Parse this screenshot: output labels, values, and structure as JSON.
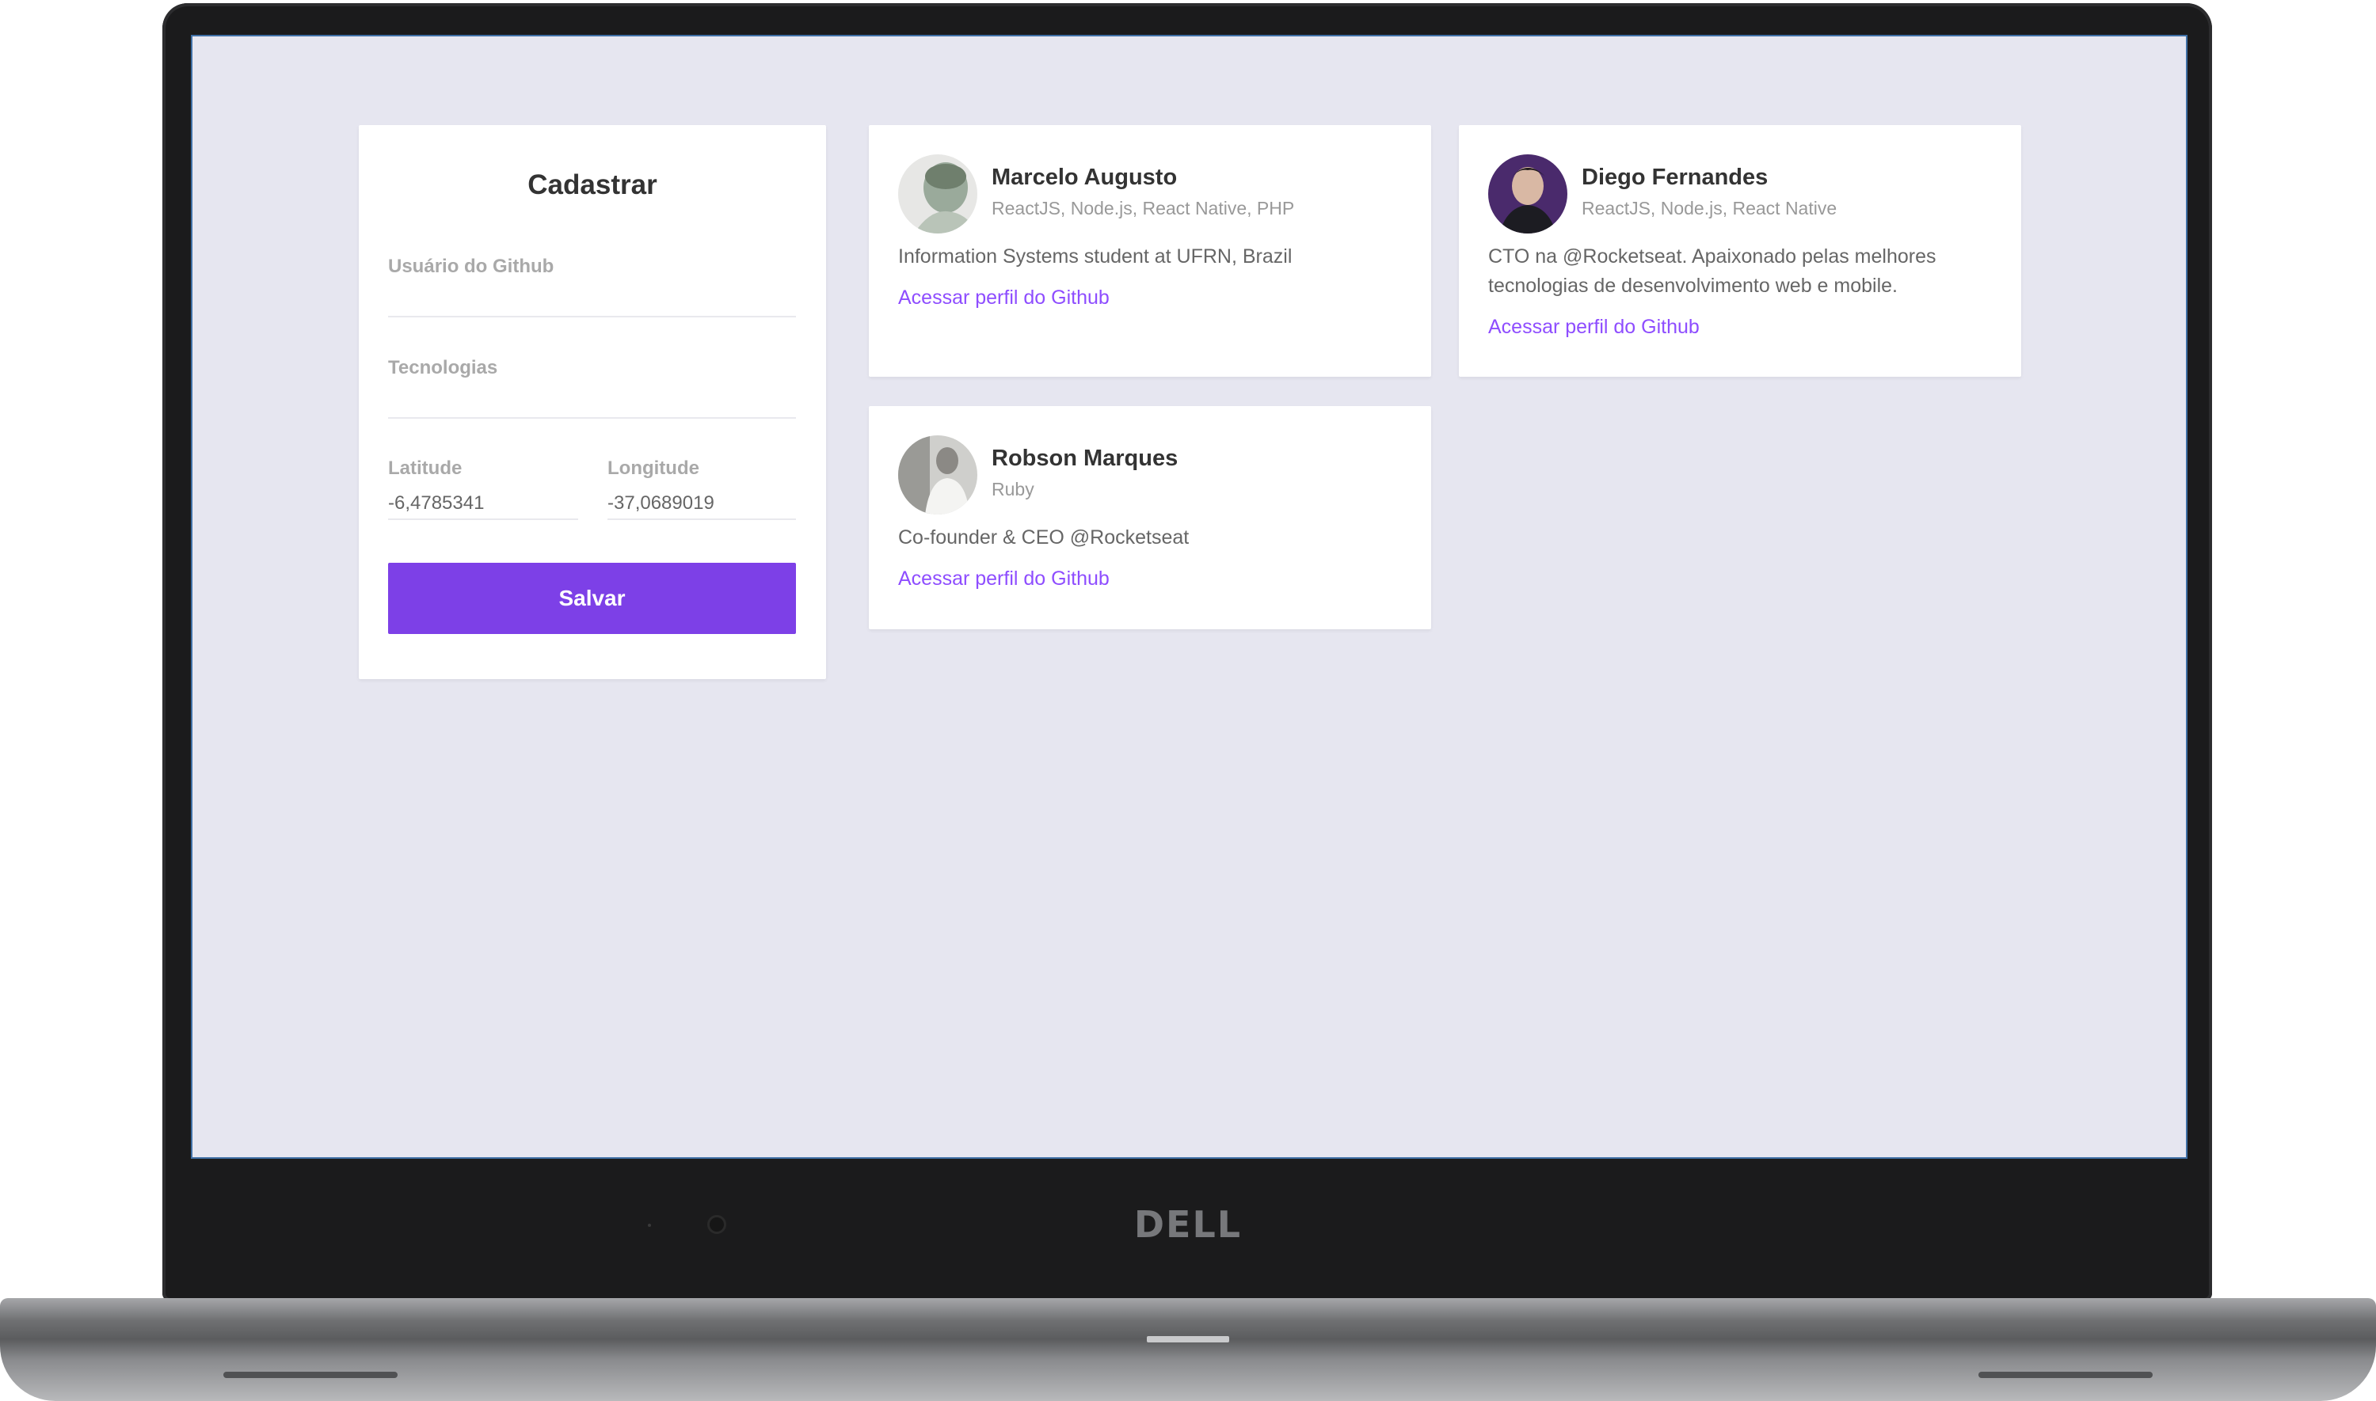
{
  "device": {
    "logo": "DELL"
  },
  "form": {
    "title": "Cadastrar",
    "github_label": "Usuário do Github",
    "github_value": "",
    "techs_label": "Tecnologias",
    "techs_value": "",
    "latitude_label": "Latitude",
    "latitude_value": "-6,4785341",
    "longitude_label": "Longitude",
    "longitude_value": "-37,0689019",
    "submit_label": "Salvar"
  },
  "devs": [
    {
      "name": "Marcelo Augusto",
      "techs": "ReactJS, Node.js, React Native, PHP",
      "bio": "Information Systems student at UFRN, Brazil",
      "link": "Acessar perfil do Github"
    },
    {
      "name": "Diego Fernandes",
      "techs": "ReactJS, Node.js, React Native",
      "bio": "CTO na @Rocketseat. Apaixonado pelas melhores tecnologias de desenvolvimento web e mobile.",
      "link": "Acessar perfil do Github"
    },
    {
      "name": "Robson Marques",
      "techs": "Ruby",
      "bio": "Co-founder & CEO @Rocketseat",
      "link": "Acessar perfil do Github"
    }
  ],
  "colors": {
    "primary": "#7d40e7",
    "link": "#8e4dff",
    "background": "#e6e6f0"
  }
}
